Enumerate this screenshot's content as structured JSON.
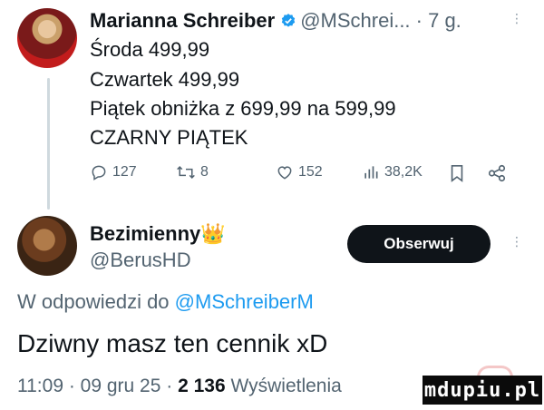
{
  "tweet": {
    "author_name": "Marianna Schreiber",
    "handle_time": "@MSchrei... · 7 g.",
    "lines": [
      "Środa 499,99",
      "Czwartek 499,99",
      "Piątek obniżka z 699,99 na 599,99",
      "CZARNY PIĄTEK"
    ],
    "actions": {
      "replies": "127",
      "retweets": "8",
      "likes": "152",
      "views": "38,2K"
    }
  },
  "reply": {
    "author_name": "Bezimienny👑",
    "handle": "@BerusHD",
    "follow_label": "Obserwuj",
    "in_reply_prefix": "W odpowiedzi do",
    "in_reply_handle": "@MSchreiberM",
    "text": "Dziwny masz ten cennik xD",
    "meta_prefix": "11:09 · 09 gru 25 ·",
    "views_count": "2 136",
    "views_label": "Wyświetlenia"
  },
  "watermark": "mdupiu.pl",
  "colors": {
    "accent": "#1d9bf0",
    "muted": "#536471",
    "button": "#0f1419"
  }
}
